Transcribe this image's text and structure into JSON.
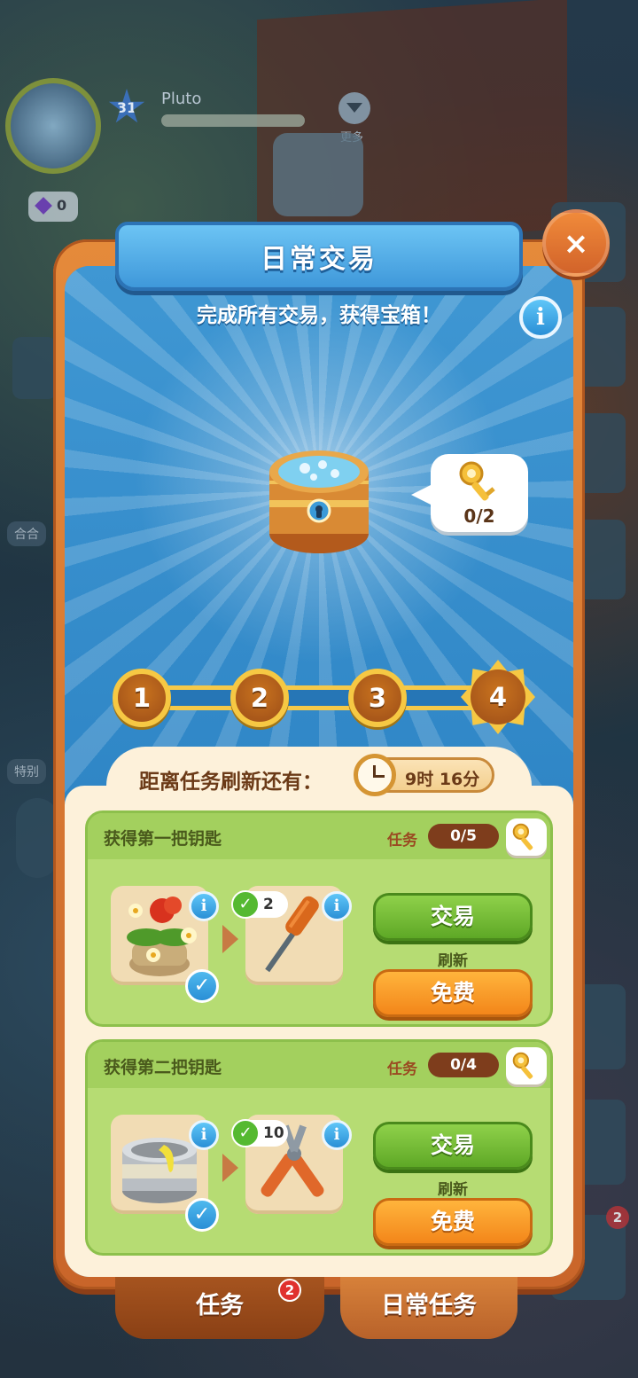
{
  "background": {
    "player_name": "Pluto",
    "level": "31",
    "more_label": "更多",
    "gems": "0",
    "side_labels": [
      "合合",
      "特别"
    ],
    "corner_badge": "2"
  },
  "dialog": {
    "title": "日常交易",
    "close_icon": "×",
    "subtitle": "完成所有交易，获得宝箱！",
    "info_icon": "i",
    "chest": {
      "key_count": "0/2"
    },
    "progress_steps": [
      "1",
      "2",
      "3",
      "4"
    ],
    "refresh": {
      "label": "距离任务刷新还有：",
      "time": "9时 16分"
    },
    "tasks": [
      {
        "title": "获得第一把钥匙",
        "task_label": "任务",
        "progress": "0/5",
        "required_count": "2",
        "trade_label": "交易",
        "refresh_label": "刷新",
        "free_label": "免费"
      },
      {
        "title": "获得第二把钥匙",
        "task_label": "任务",
        "progress": "0/4",
        "required_count": "10",
        "trade_label": "交易",
        "refresh_label": "刷新",
        "free_label": "免费"
      }
    ]
  },
  "tabs": {
    "tasks_label": "任务",
    "tasks_badge": "2",
    "daily_label": "日常任务"
  },
  "colors": {
    "panel_orange": "#e58a3a",
    "panel_blue": "#3b8fcb",
    "card_green": "#b6dc73",
    "trade_green": "#6db22e",
    "free_orange": "#f79a22"
  }
}
